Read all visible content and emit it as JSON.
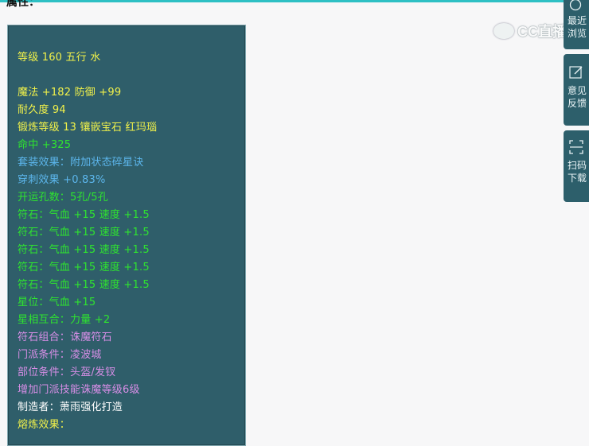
{
  "section_title": "属性：",
  "watermark": "CC直播",
  "item_lines": [
    {
      "text": "等级 160 五行 水",
      "color": "yellow"
    },
    {
      "text": "魔法 +182 防御 +99",
      "color": "yellow",
      "gap": true
    },
    {
      "text": "耐久度 94",
      "color": "yellow"
    },
    {
      "text": "锻炼等级 13 镶嵌宝石 红玛瑙",
      "color": "yellow"
    },
    {
      "text": "命中 +325",
      "color": "green"
    },
    {
      "text": "套装效果：附加状态碎星诀",
      "color": "blue"
    },
    {
      "text": "穿刺效果 +0.83%",
      "color": "blue"
    },
    {
      "text": "开运孔数：5孔/5孔",
      "color": "green"
    },
    {
      "text": "符石：气血 +15 速度 +1.5",
      "color": "green"
    },
    {
      "text": "符石：气血 +15 速度 +1.5",
      "color": "green"
    },
    {
      "text": "符石：气血 +15 速度 +1.5",
      "color": "green"
    },
    {
      "text": "符石：气血 +15 速度 +1.5",
      "color": "green"
    },
    {
      "text": "符石：气血 +15 速度 +1.5",
      "color": "green"
    },
    {
      "text": "星位：气血 +15",
      "color": "green"
    },
    {
      "text": "星相互合：力量 +2",
      "color": "green"
    },
    {
      "text": "符石组合：诛魔符石",
      "color": "purple"
    },
    {
      "text": "门派条件：凌波城",
      "color": "purple"
    },
    {
      "text": "部位条件：头盔/发钗",
      "color": "purple"
    },
    {
      "text": "增加门派技能诛魔等级6级",
      "color": "purple"
    },
    {
      "text": "制造者：萧雨强化打造",
      "color": "white"
    },
    {
      "text": "熔炼效果：",
      "color": "yellow"
    }
  ],
  "sidebar": {
    "recent": {
      "line1": "最近",
      "line2": "浏览",
      "icon": "clock-icon"
    },
    "feedback": {
      "line1": "意见",
      "line2": "反馈",
      "icon": "edit-icon"
    },
    "scan": {
      "line1": "扫码",
      "line2": "下载",
      "icon": "scan-icon"
    }
  },
  "colors": {
    "yellow": "#f2f24a",
    "green": "#2fe42f",
    "blue": "#5cb6ec",
    "purple": "#d78ee6",
    "white": "#ffffff",
    "panel": "#2f5e6a",
    "accent": "#2ec0c4"
  }
}
